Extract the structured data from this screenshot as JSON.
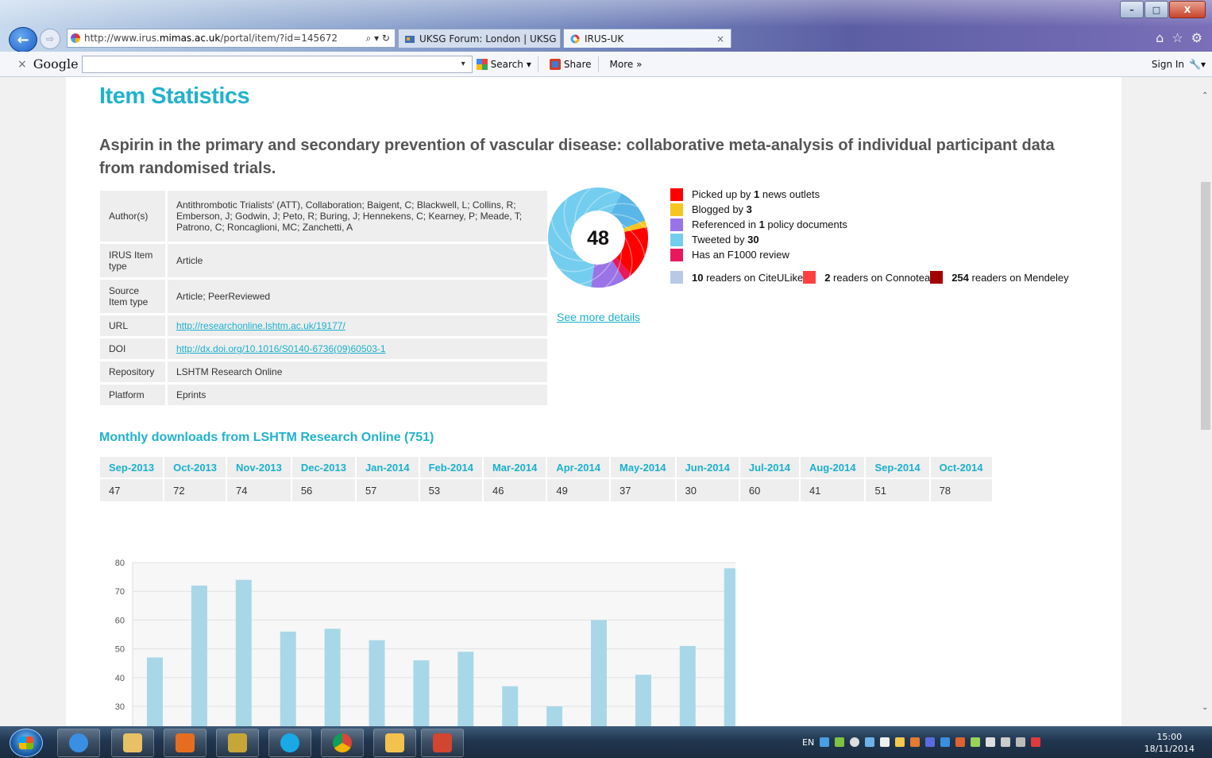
{
  "browser": {
    "url_prefix": "http://www.irus.",
    "url_domain": "mimas.ac.uk",
    "url_suffix": "/portal/item/?id=145672",
    "addr_tools": "⌕ ▾ ↻",
    "tabs": [
      {
        "label": "UKSG Forum: London | UKSG"
      },
      {
        "label": "IRUS-UK",
        "close": "×"
      }
    ],
    "window_buttons": {
      "minimize": "–",
      "maximize": "□",
      "close": "X"
    }
  },
  "google_toolbar": {
    "close": "×",
    "logo": "Google",
    "dropdown": "▾",
    "search_label": "Search",
    "share_label": "Share",
    "more_label": "More »",
    "signin_label": "Sign In"
  },
  "page": {
    "heading": "Item Statistics",
    "title": "Aspirin in the primary and secondary prevention of vascular disease: collaborative meta-analysis of individual participant data from randomised trials.",
    "meta": [
      {
        "key": "Author(s)",
        "value": "Antithrombotic Trialists' (ATT), Collaboration; Baigent, C; Blackwell, L; Collins, R; Emberson, J; Godwin, J; Peto, R; Buring, J; Hennekens, C; Kearney, P; Meade, T; Patrono, C; Roncaglioni, MC; Zanchetti, A"
      },
      {
        "key": "IRUS Item type",
        "value": "Article"
      },
      {
        "key": "Source Item type",
        "value": "Article; PeerReviewed"
      },
      {
        "key": "URL",
        "value": "http://researchonline.lshtm.ac.uk/19177/",
        "link": true
      },
      {
        "key": "DOI",
        "value": "http://dx.doi.org/10.1016/S0140-6736(09)60503-1",
        "link": true
      },
      {
        "key": "Repository",
        "value": "LSHTM Research Online"
      },
      {
        "key": "Platform",
        "value": "Eprints"
      }
    ],
    "altmetric": {
      "score": "48",
      "see_more": "See more details",
      "legend": [
        {
          "color": "#ff0000",
          "pre": "Picked up by ",
          "num": "1",
          "post": " news outlets"
        },
        {
          "color": "#f6c520",
          "pre": "Blogged by ",
          "num": "3",
          "post": ""
        },
        {
          "color": "#9a74e6",
          "pre": "Referenced in ",
          "num": "1",
          "post": " policy documents"
        },
        {
          "color": "#73cdef",
          "pre": "Tweeted by ",
          "num": "30",
          "post": ""
        },
        {
          "color": "#e8185b",
          "pre": "Has an F1000 review",
          "num": "",
          "post": ""
        }
      ],
      "readers": [
        {
          "color": "#b7c9e6",
          "num": "10",
          "text": " readers on CiteULike"
        },
        {
          "color": "#ff4040",
          "num": "2",
          "text": " readers on Connotea"
        },
        {
          "color": "#a50000",
          "num": "254",
          "text": " readers on Mendeley"
        }
      ]
    },
    "downloads_heading": "Monthly downloads from LSHTM Research Online (751)"
  },
  "chart_data": {
    "type": "bar",
    "categories": [
      "Sep-2013",
      "Oct-2013",
      "Nov-2013",
      "Dec-2013",
      "Jan-2014",
      "Feb-2014",
      "Mar-2014",
      "Apr-2014",
      "May-2014",
      "Jun-2014",
      "Jul-2014",
      "Aug-2014",
      "Sep-2014",
      "Oct-2014"
    ],
    "values": [
      47,
      72,
      74,
      56,
      57,
      53,
      46,
      49,
      37,
      30,
      60,
      41,
      51,
      78
    ],
    "ylim": [
      0,
      80
    ],
    "yticks": [
      30,
      40,
      50,
      60,
      70,
      80
    ],
    "bar_color": "#a8d8e8",
    "grid": true
  },
  "taskbar": {
    "lang": "EN",
    "time": "15:00",
    "date": "18/11/2014"
  }
}
